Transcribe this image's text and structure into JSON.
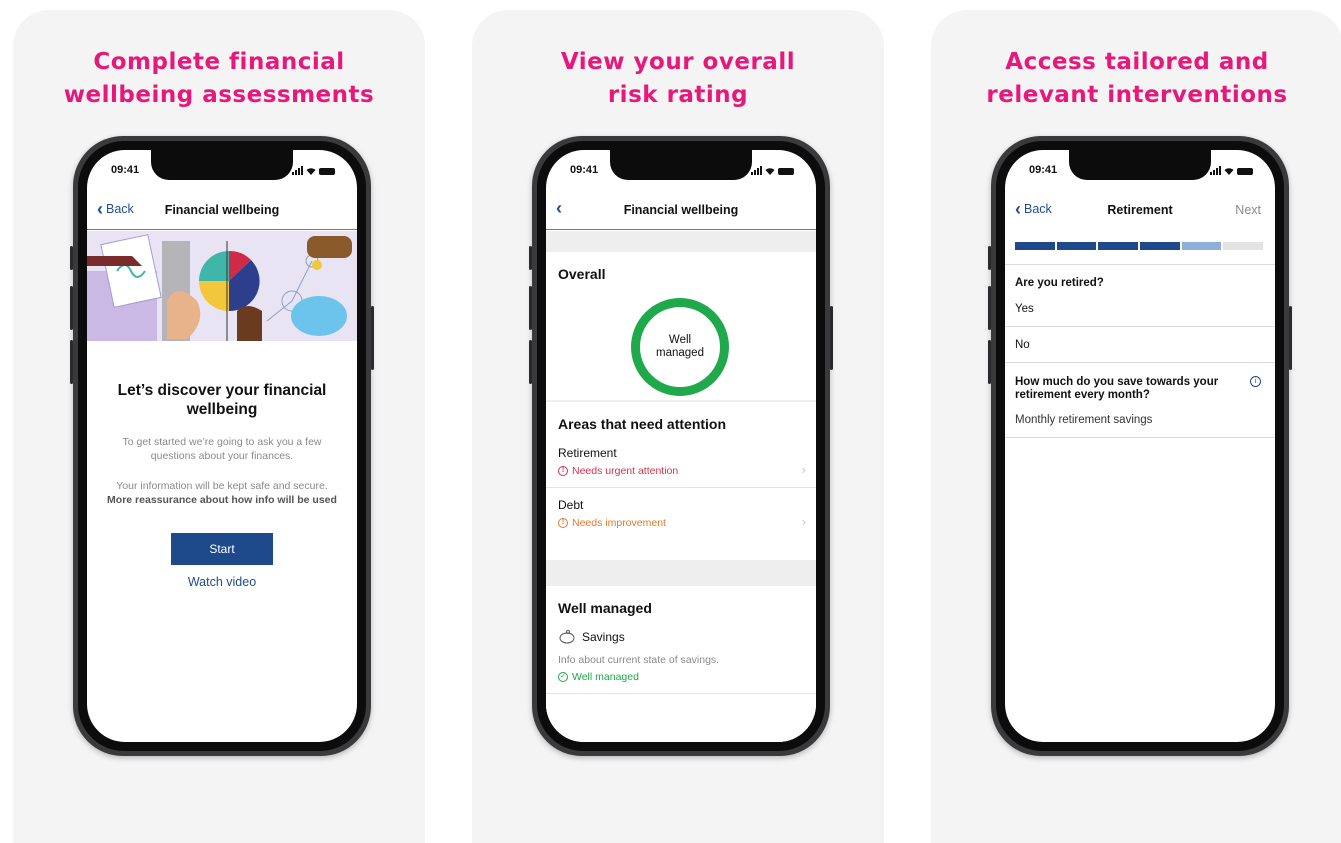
{
  "cards": [
    {
      "title_line1": "Complete financial",
      "title_line2": "wellbeing assessments",
      "status_time": "09:41",
      "nav_back": "Back",
      "nav_title": "Financial wellbeing",
      "heading": "Let’s discover your financial wellbeing",
      "intro": "To get started we’re going to ask you a few questions about your finances.",
      "safe_text": "Your information will be kept safe and secure.",
      "safe_link": "More reassurance about how info will be used",
      "start_label": "Start",
      "watch_label": "Watch video"
    },
    {
      "title_line1": "View your overall",
      "title_line2": "risk rating",
      "status_time": "09:41",
      "nav_title": "Financial wellbeing",
      "overall_heading": "Overall",
      "overall_rating_line1": "Well",
      "overall_rating_line2": "managed",
      "attention_heading": "Areas that need attention",
      "attention_items": [
        {
          "title": "Retirement",
          "status": "Needs urgent attention"
        },
        {
          "title": "Debt",
          "status": "Needs improvement"
        }
      ],
      "managed_heading": "Well managed",
      "managed_items": [
        {
          "title": "Savings",
          "desc": "Info about current state of savings.",
          "status": "Well managed"
        }
      ]
    },
    {
      "title_line1": "Access tailored and",
      "title_line2": "relevant interventions",
      "status_time": "09:41",
      "nav_back": "Back",
      "nav_title": "Retirement",
      "nav_next": "Next",
      "progress_segments_complete": 4,
      "progress_segments_partial": 1,
      "progress_segments_total": 6,
      "question1": "Are you retired?",
      "options": [
        "Yes",
        "No"
      ],
      "question2": "How much do you save towards your retirement every month?",
      "field_label": "Monthly retirement savings"
    }
  ],
  "colors": {
    "title_pink": "#e6197a",
    "primary_blue": "#1e4a8c",
    "good_green": "#1fa94a",
    "urgent_red": "#d0334f",
    "improve_orange": "#e07a2d"
  }
}
